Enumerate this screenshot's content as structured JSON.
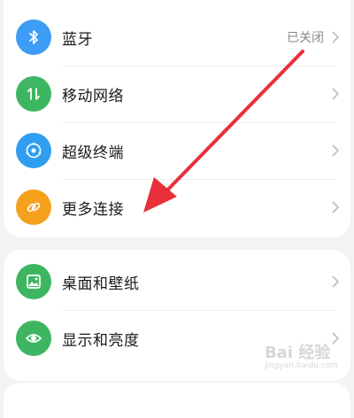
{
  "connectivity": {
    "items": [
      {
        "label": "蓝牙",
        "value": "已关闭",
        "icon": "bluetooth-icon",
        "color": "#3d9cf5"
      },
      {
        "label": "移动网络",
        "value": "",
        "icon": "mobile-data-icon",
        "color": "#3eb661"
      },
      {
        "label": "超级终端",
        "value": "",
        "icon": "super-device-icon",
        "color": "#2f9ef0"
      },
      {
        "label": "更多连接",
        "value": "",
        "icon": "link-icon",
        "color": "#f5a11c"
      }
    ]
  },
  "display": {
    "items": [
      {
        "label": "桌面和壁纸",
        "icon": "wallpaper-icon",
        "color": "#3eb661"
      },
      {
        "label": "显示和亮度",
        "icon": "eye-icon",
        "color": "#3eb661"
      }
    ]
  },
  "annotation": {
    "arrow_color": "#e8303a"
  },
  "watermark": {
    "text": "Bai 经验",
    "sub": "jingyan.baidu.com"
  }
}
